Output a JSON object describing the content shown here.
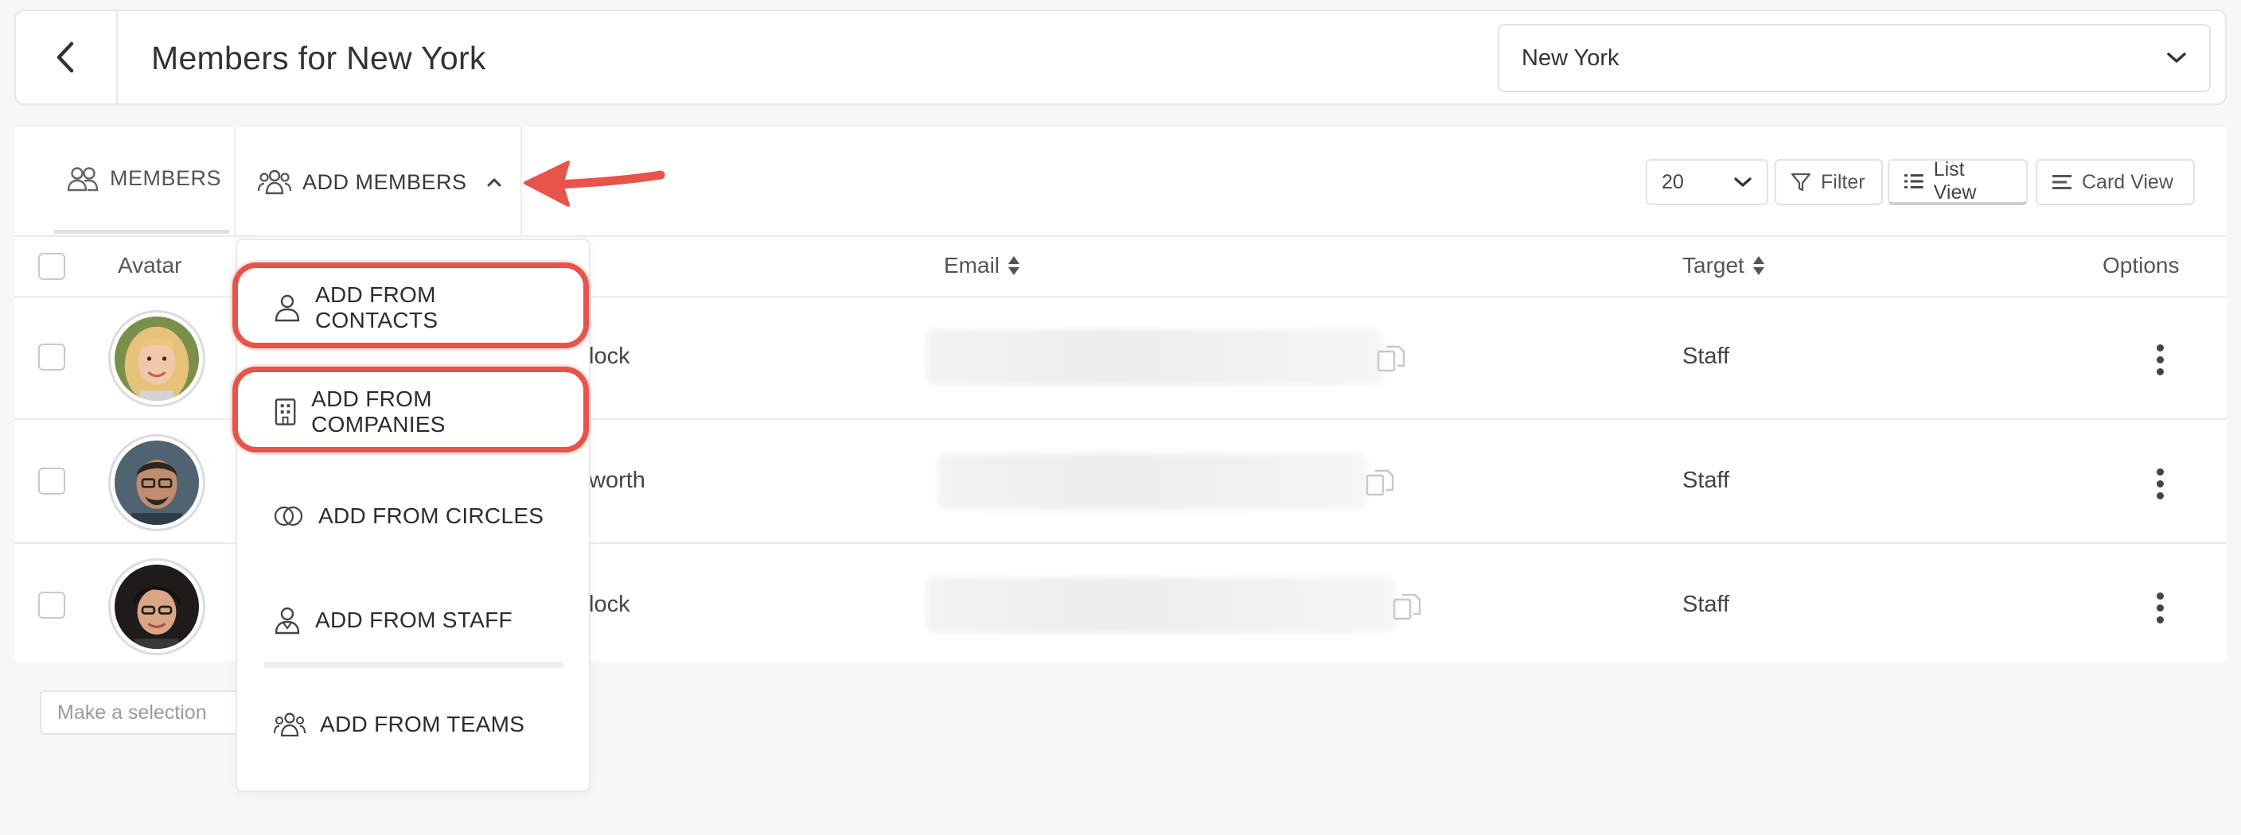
{
  "header": {
    "title": "Members for New York",
    "city_select_value": "New York"
  },
  "tabs": {
    "members_label": "MEMBERS",
    "add_members_label": "ADD MEMBERS"
  },
  "controls": {
    "page_size": "20",
    "filter_label": "Filter",
    "list_view_label": "List View",
    "card_view_label": "Card View"
  },
  "table": {
    "headers": {
      "avatar": "Avatar",
      "email": "Email",
      "target": "Target",
      "options": "Options"
    },
    "rows": [
      {
        "name_fragment": "lock",
        "email": "",
        "target": "Staff"
      },
      {
        "name_fragment": "worth",
        "email": "",
        "target": "Staff"
      },
      {
        "name_fragment": "lock",
        "email": "",
        "target": "Staff"
      }
    ]
  },
  "selection_placeholder": "Make a selection",
  "dropdown": {
    "items": [
      {
        "label": "ADD FROM CONTACTS",
        "icon": "person-icon",
        "highlighted": true
      },
      {
        "label": "ADD FROM COMPANIES",
        "icon": "building-icon",
        "highlighted": true
      },
      {
        "label": "ADD FROM CIRCLES",
        "icon": "circles-icon",
        "highlighted": false
      },
      {
        "label": "ADD FROM STAFF",
        "icon": "staff-icon",
        "highlighted": false
      },
      {
        "label": "ADD FROM TEAMS",
        "icon": "team-icon",
        "highlighted": false
      }
    ]
  },
  "colors": {
    "highlight": "#e8534a",
    "arrow": "#e8534a",
    "text": "#3a3a3a",
    "border": "#e6e6e6"
  }
}
